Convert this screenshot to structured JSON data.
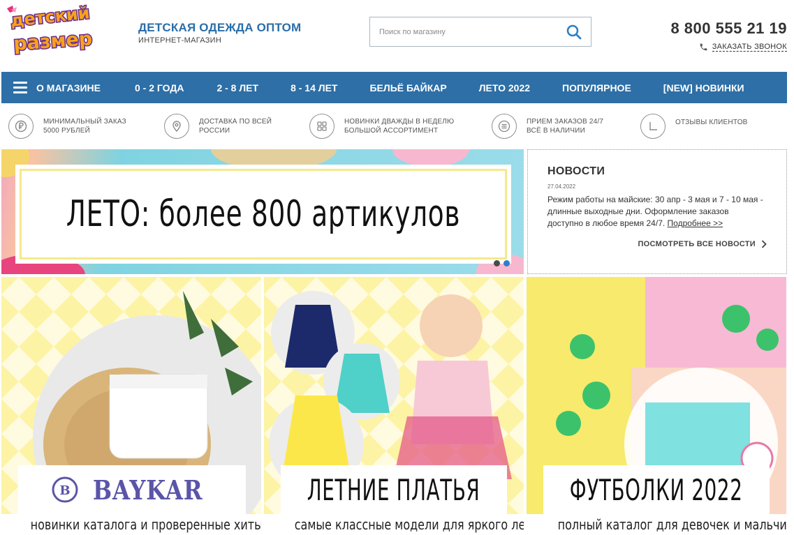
{
  "header": {
    "logo_text_line1": "детский",
    "logo_text_line2": "размер",
    "tagline_title": "ДЕТСКАЯ ОДЕЖДА ОПТОМ",
    "tagline_sub": "ИНТЕРНЕТ-МАГАЗИН",
    "search_placeholder": "Поиск по магазину",
    "phone": "8 800 555 21 19",
    "callback_label": "ЗАКАЗАТЬ ЗВОНОК"
  },
  "nav": {
    "items": [
      "О МАГАЗИНЕ",
      "0 - 2 ГОДА",
      "2 - 8 ЛЕТ",
      "8 - 14 ЛЕТ",
      "БЕЛЬЁ БАЙКАР",
      "ЛЕТО 2022",
      "ПОПУЛЯРНОЕ",
      "[NEW] НОВИНКИ"
    ]
  },
  "features": [
    {
      "icon": "ruble-icon",
      "text": "МИНИМАЛЬНЫЙ ЗАКАЗ\n5000 РУБЛЕЙ"
    },
    {
      "icon": "location-pin-icon",
      "text": "ДОСТАВКА ПО ВСЕЙ\nРОССИИ"
    },
    {
      "icon": "grid-icon",
      "text": "НОВИНКИ ДВАЖДЫ В НЕДЕЛЮ\nБОЛЬШОЙ АССОРТИМЕНТ"
    },
    {
      "icon": "list-icon",
      "text": "ПРИЕМ ЗАКАЗОВ 24/7\nВСЁ В НАЛИЧИИ"
    },
    {
      "icon": "clock-icon",
      "text": "ОТЗЫВЫ КЛИЕНТОВ"
    }
  ],
  "banner": {
    "headline": "ЛЕТО: более 800 артикулов",
    "slide_count": 2,
    "active_slide": 2
  },
  "news": {
    "heading": "НОВОСТИ",
    "date": "27.04.2022",
    "body": "Режим работы на майские: 30 апр - 3 мая и 7 - 10 мая - длинные выходные дни. Оформление заказов доступно в любое время 24/7.",
    "more_link": "Подробнее >>",
    "all_link": "ПОСМОТРЕТЬ ВСЕ НОВОСТИ"
  },
  "tiles": [
    {
      "label": "BAYKAR",
      "caption": "новинки каталога и проверенные хиты"
    },
    {
      "label": "ЛЕТНИЕ ПЛАТЬЯ",
      "caption": "самые классные модели для яркого лета"
    },
    {
      "label": "ФУТБОЛКИ 2022",
      "caption": "полный каталог для девочек и мальчиков"
    }
  ],
  "colors": {
    "brand_blue": "#2d6fa6",
    "logo_orange": "#f7a21b",
    "logo_purple": "#6a2c91",
    "slider_active": "#2d80c8"
  }
}
